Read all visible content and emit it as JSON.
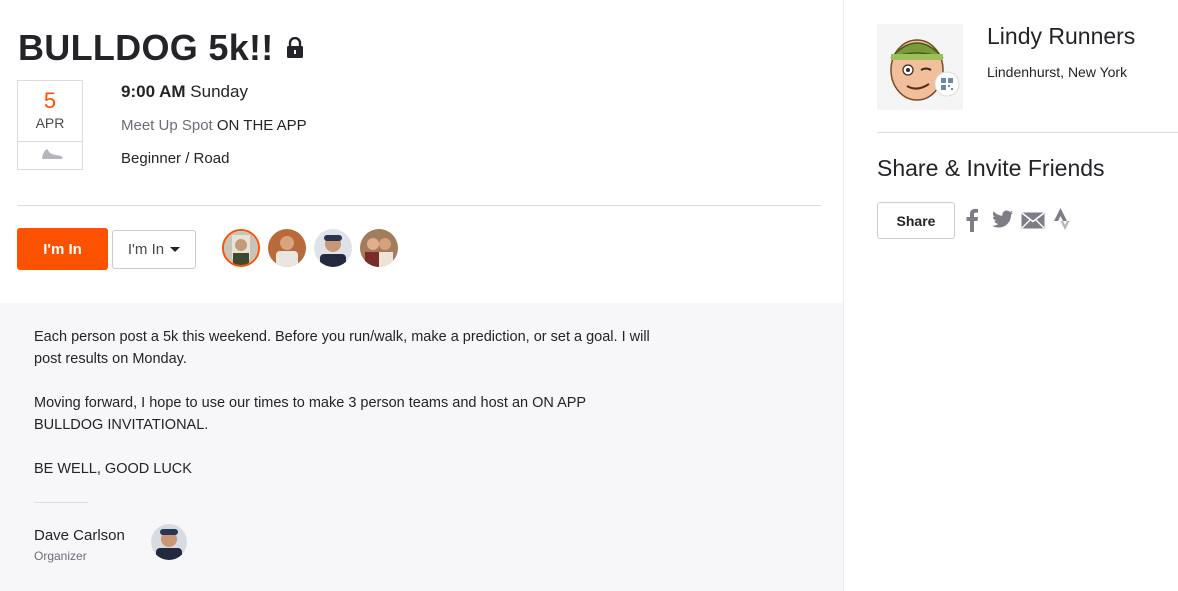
{
  "event": {
    "title": "BULLDOG 5k!!",
    "date_day": "5",
    "date_month": "APR",
    "time": "9:00 AM",
    "weekday": "Sunday",
    "meet_label": "Meet Up Spot",
    "meet_value": "ON THE APP",
    "level": "Beginner / Road"
  },
  "actions": {
    "join_label": "I'm In",
    "status_label": "I'm In"
  },
  "description": {
    "paragraphs": [
      "Each person post a 5k this weekend. Before you run/walk, make a prediction, or set a goal. I will post results on Monday.",
      "Moving forward, I hope to use our times to make 3 person teams and host an ON APP BULLDOG INVITATIONAL.",
      "BE WELL, GOOD LUCK"
    ]
  },
  "organizer": {
    "name": "Dave Carlson",
    "role": "Organizer"
  },
  "club": {
    "name": "Lindy Runners",
    "location": "Lindenhurst, New York"
  },
  "share": {
    "title": "Share & Invite Friends",
    "button_label": "Share",
    "icons": [
      "facebook-icon",
      "twitter-icon",
      "email-icon",
      "strava-icon"
    ]
  },
  "colors": {
    "accent": "#fc5200",
    "panel_bg": "#f7f7fa"
  }
}
